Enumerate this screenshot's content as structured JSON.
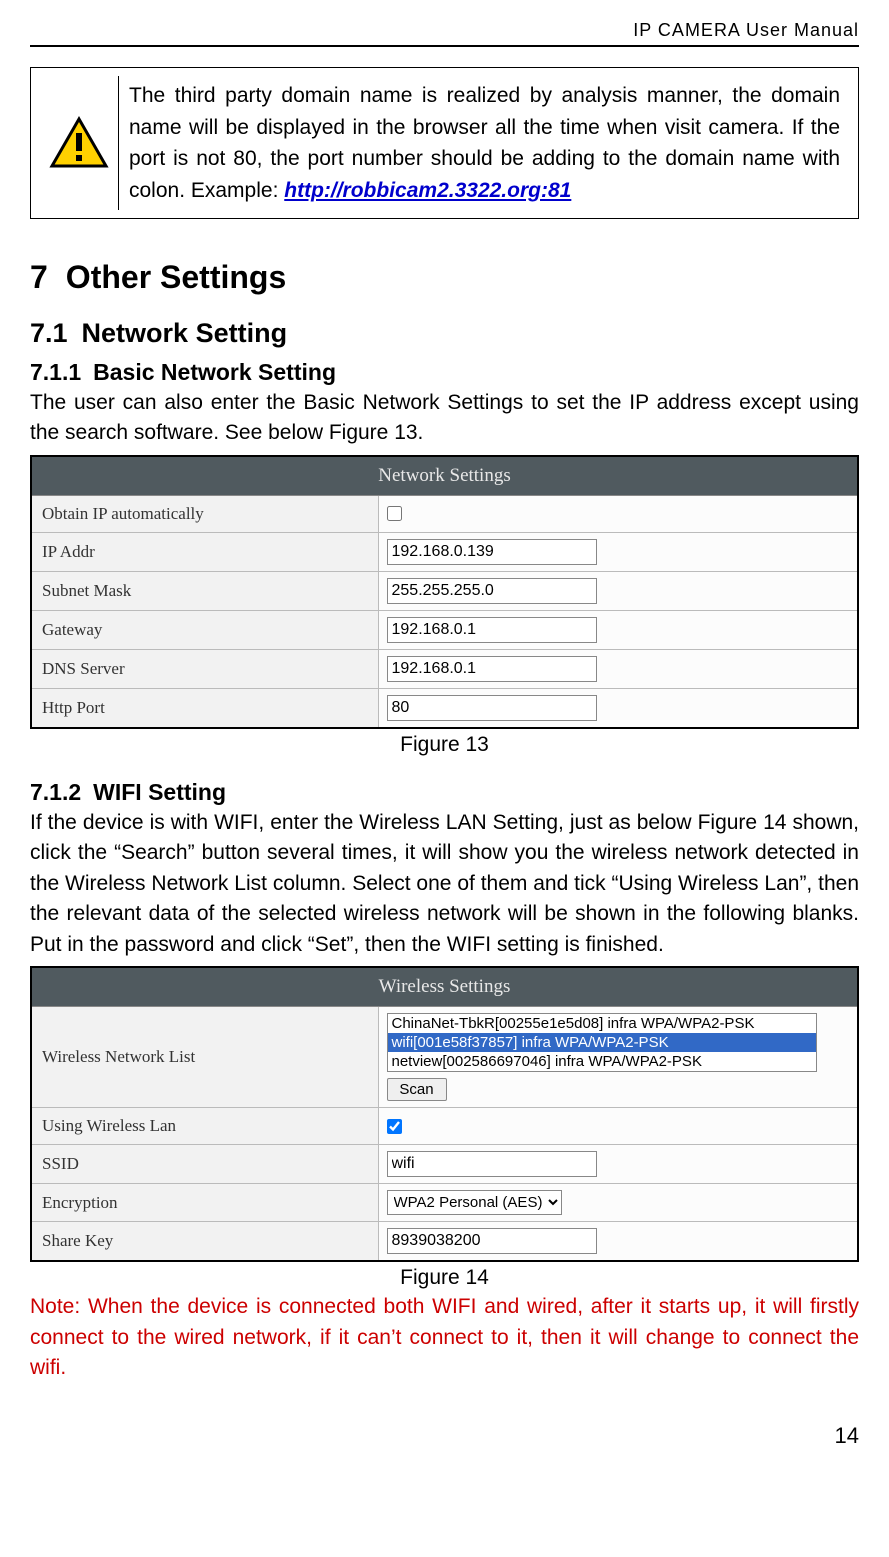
{
  "header": {
    "title": "IP CAMERA User Manual"
  },
  "warning": {
    "text_before_link": "The third party domain name is realized by analysis manner, the domain name will be displayed in the browser all the time when visit camera. If the port is not 80, the port number should be adding to the domain name with colon. Example: ",
    "link_text": "http://robbicam2.3322.org:81"
  },
  "section7": {
    "num": "7",
    "title": "Other Settings"
  },
  "section71": {
    "num": "7.1",
    "title": "Network Setting"
  },
  "section711": {
    "num": "7.1.1",
    "title": "Basic Network Setting",
    "body": "The user can also enter the Basic Network Settings to set the IP address except using the search software. See below Figure 13."
  },
  "figure13": {
    "panel_title": "Network Settings",
    "rows": {
      "obtain_ip": {
        "label": "Obtain IP automatically",
        "checked": false
      },
      "ip_addr": {
        "label": "IP Addr",
        "value": "192.168.0.139"
      },
      "subnet": {
        "label": "Subnet Mask",
        "value": "255.255.255.0"
      },
      "gateway": {
        "label": "Gateway",
        "value": "192.168.0.1"
      },
      "dns": {
        "label": "DNS Server",
        "value": "192.168.0.1"
      },
      "http_port": {
        "label": "Http Port",
        "value": "80"
      }
    },
    "caption": "Figure 13"
  },
  "section712": {
    "num": "7.1.2",
    "title": "WIFI Setting",
    "body": "If the device is with WIFI, enter the Wireless LAN Setting, just as below Figure 14 shown, click the “Search” button several times, it will show you the wireless network detected in the Wireless Network List column. Select one of them and tick “Using Wireless Lan”, then the relevant data of the selected wireless network will be shown in the following blanks. Put in the password and click “Set”, then the WIFI setting is finished."
  },
  "figure14": {
    "panel_title": "Wireless Settings",
    "list_label": "Wireless Network List",
    "networks": [
      {
        "text": "ChinaNet-TbkR[00255e1e5d08] infra WPA/WPA2-PSK",
        "selected": false
      },
      {
        "text": "wifi[001e58f37857] infra WPA/WPA2-PSK",
        "selected": true
      },
      {
        "text": "netview[002586697046] infra WPA/WPA2-PSK",
        "selected": false
      }
    ],
    "scan_label": "Scan",
    "rows": {
      "using_wlan": {
        "label": "Using Wireless Lan",
        "checked": true
      },
      "ssid": {
        "label": "SSID",
        "value": "wifi"
      },
      "encryption": {
        "label": "Encryption",
        "value": "WPA2 Personal (AES)"
      },
      "share_key": {
        "label": "Share Key",
        "value": "8939038200"
      }
    },
    "caption": "Figure 14"
  },
  "note": "Note: When the device is connected both WIFI and wired, after it starts up, it will firstly connect to the wired network, if it can’t connect to it, then it will change to connect the wifi.",
  "page_number": "14"
}
